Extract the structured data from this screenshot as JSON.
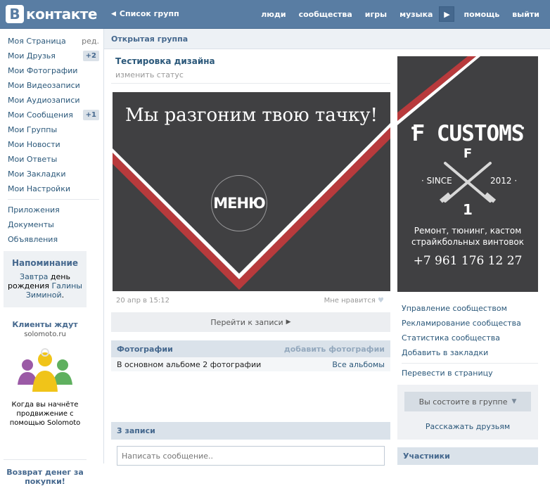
{
  "header": {
    "logo_letter": "B",
    "logo_text": "контакте",
    "back_label": "Список групп",
    "nav": [
      "люди",
      "сообщества",
      "игры",
      "музыка",
      "помощь",
      "выйти"
    ]
  },
  "sidebar": {
    "items": [
      {
        "label": "Моя Страница",
        "extra": "ред."
      },
      {
        "label": "Мои Друзья",
        "badge": "+2"
      },
      {
        "label": "Мои Фотографии"
      },
      {
        "label": "Мои Видеозаписи"
      },
      {
        "label": "Мои Аудиозаписи"
      },
      {
        "label": "Мои Сообщения",
        "badge": "+1"
      },
      {
        "label": "Мои Группы"
      },
      {
        "label": "Мои Новости"
      },
      {
        "label": "Мои Ответы"
      },
      {
        "label": "Мои Закладки"
      },
      {
        "label": "Мои Настройки"
      }
    ],
    "items2": [
      "Приложения",
      "Документы",
      "Объявления"
    ],
    "reminder": {
      "title": "Напоминание",
      "pre": "Завтра",
      "mid": " день рождения ",
      "name": "Галины Зиминой",
      "post": "."
    },
    "ad1": {
      "title": "Клиенты ждут",
      "domain": "solomoto.ru",
      "text": "Когда вы начнёте продвижение с помощью Solomoto"
    },
    "ad2": {
      "title": "Возврат денег за покупки!"
    }
  },
  "content": {
    "crumb": "Открытая группа",
    "group_title": "Тестировка дизайна",
    "status": "изменить статус",
    "wiki_heading": "Мы разгоним твою тачку!",
    "wiki_menu": "МЕНЮ",
    "post_date": "20 апр в 15:12",
    "like_label": "Мне нравится",
    "goto_label": "Перейти к записи",
    "photos": {
      "title": "Фотографии",
      "add": "добавить фотографии",
      "desc": "В основном альбоме 2 фотографии",
      "all": "Все альбомы"
    },
    "wall_title": "3 записи",
    "wall_placeholder": "Написать сообщение.."
  },
  "right": {
    "cover": {
      "title": "F CUSTOMS",
      "f": "F",
      "since": "· SINCE",
      "year": "2012 ·",
      "one": "1",
      "desc_line1": "Ремонт, тюнинг, кастом",
      "desc_line2": "страйкбольных винтовок",
      "phone": "+7  961  176  12  27"
    },
    "links": [
      "Управление сообществом",
      "Рекламирование сообщества",
      "Статистика сообщества",
      "Добавить в закладки"
    ],
    "link_extra": "Перевести в страницу",
    "join_label": "Вы состоите в группе",
    "tell_friends": "Расскажать друзьям",
    "members": "Участники"
  },
  "colors": {
    "header_bg": "#597da3",
    "link": "#2b587a",
    "cover_bg": "#404042",
    "stripe_red": "#b83a3c"
  }
}
